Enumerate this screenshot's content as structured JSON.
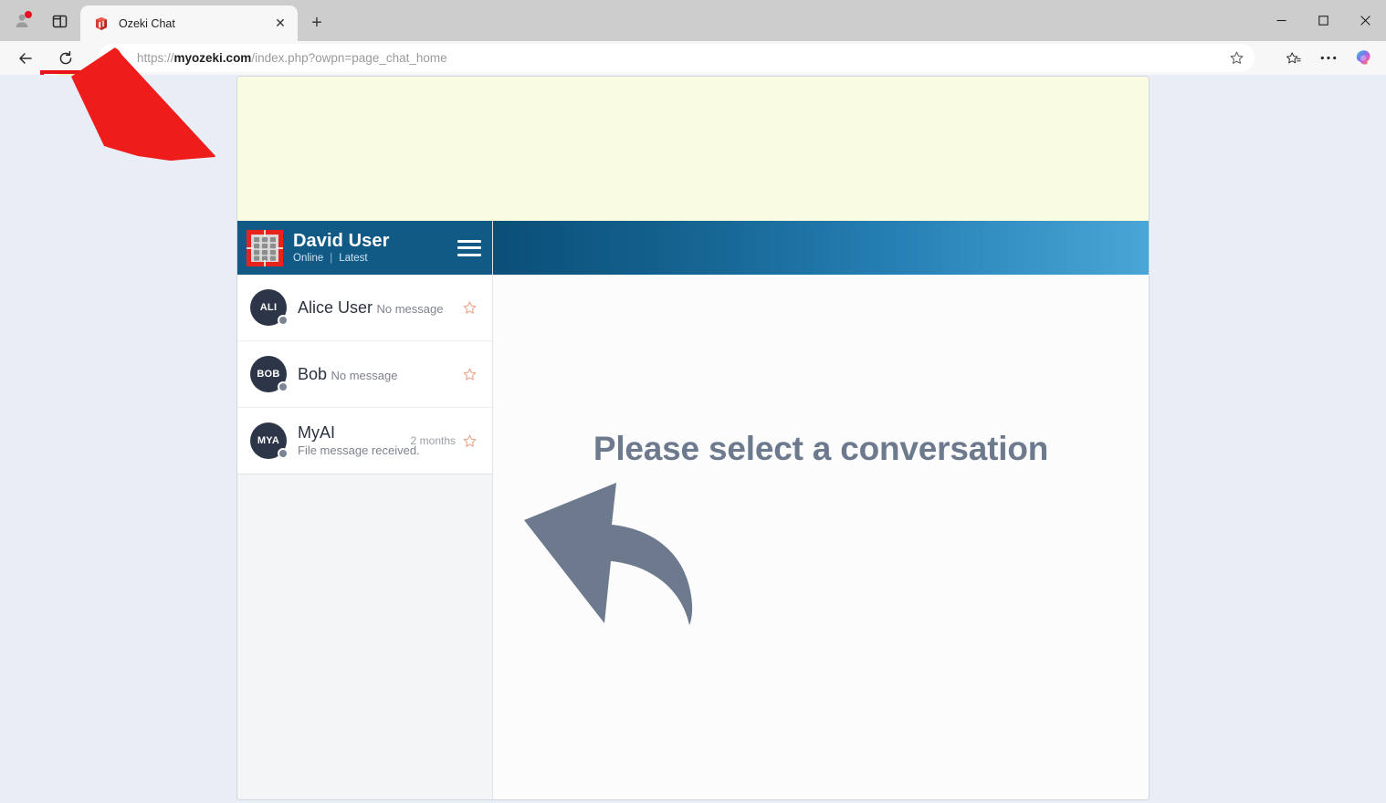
{
  "browser": {
    "window_controls": {
      "minimize": "—",
      "maximize": "□",
      "close": "✕"
    },
    "profile_icon": "profile-icon",
    "splitscreen_icon": "split-screen-icon",
    "tab": {
      "title": "Ozeki Chat",
      "favicon": "ozeki-cube-favicon",
      "close_label": "✕"
    },
    "new_tab_label": "+",
    "back_label": "←",
    "reload_label": "reload-icon",
    "url": {
      "scheme": "https://",
      "domain": "myozeki.com",
      "path": "/index.php?owpn=page_chat_home",
      "full": "https://myozeki.com/index.php?owpn=page_chat_home",
      "lock_icon": "lock-icon"
    },
    "toolbar_right": {
      "favorite_icon": "star-icon",
      "collections_icon": "collections-icon",
      "settings_icon": "ellipsis-icon",
      "copilot_icon": "copilot-icon"
    }
  },
  "app": {
    "banner": {
      "text": ""
    },
    "profile": {
      "name": "David User",
      "status": "Online",
      "separator": "|",
      "filter": "Latest",
      "avatar_icon": "ozeki-keypad-avatar",
      "menu_icon": "hamburger-menu-icon"
    },
    "contacts": [
      {
        "initials": "ALI",
        "name": "Alice User",
        "preview": "No message",
        "time": "",
        "starred": false
      },
      {
        "initials": "BOB",
        "name": "Bob",
        "preview": "No message",
        "time": "",
        "starred": false
      },
      {
        "initials": "MYA",
        "name": "MyAI",
        "preview": "File message received.",
        "time": "2 months",
        "starred": false
      }
    ],
    "conversation": {
      "empty_title": "Please select a conversation",
      "empty_arrow_icon": "curved-left-arrow-icon"
    }
  },
  "annotations": {
    "arrow": {
      "icon": "red-pointer-arrow",
      "color": "#ef1c1c",
      "target": "reload-button"
    },
    "highlight": {
      "color": "#f2f07a",
      "box_color": "#e8131b"
    }
  },
  "colors": {
    "profile_bar": "#115a86",
    "header_gradient_start": "#0a4f78",
    "header_gradient_end": "#4aa6d6",
    "banner": "#fafce1",
    "page_bg": "#e9eef6",
    "avatar_bg": "#2c3648",
    "empty_text": "#6d7a8d",
    "star": "#e8a98d"
  }
}
